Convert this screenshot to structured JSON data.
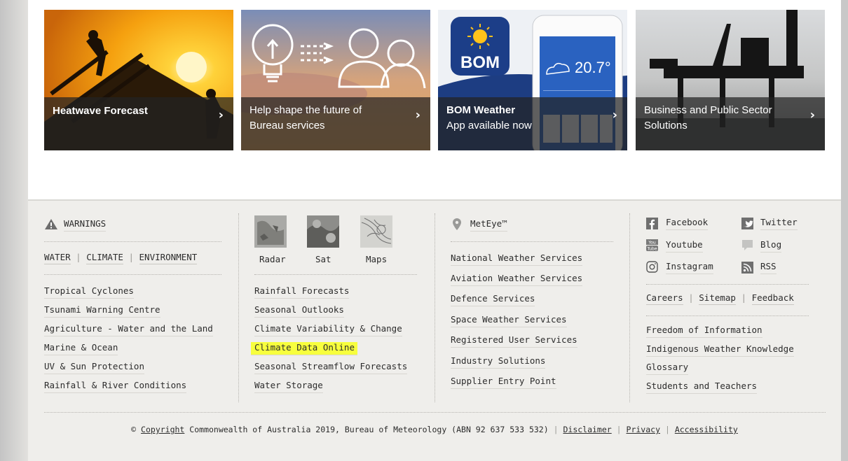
{
  "tiles": [
    {
      "title": "Heatwave Forecast",
      "subtitle": ""
    },
    {
      "title": "Help shape the future of",
      "subtitle": "Bureau services"
    },
    {
      "title": "BOM Weather",
      "subtitle": "App available now",
      "app": {
        "logo": "BOM",
        "temp": "20.7°"
      }
    },
    {
      "title": "Business and Public Sector",
      "subtitle": "Solutions"
    }
  ],
  "footer": {
    "warnings": "WARNINGS",
    "tabs": [
      "WATER",
      "CLIMATE",
      "ENVIRONMENT"
    ],
    "col1": [
      "Tropical Cyclones",
      "Tsunami Warning Centre",
      "Agriculture - Water and the Land",
      "Marine & Ocean",
      "UV & Sun Protection",
      "Rainfall & River Conditions"
    ],
    "thumbs": [
      "Radar",
      "Sat",
      "Maps"
    ],
    "col2": [
      "Rainfall Forecasts",
      "Seasonal Outlooks",
      "Climate Variability & Change",
      "Climate Data Online",
      "Seasonal Streamflow Forecasts",
      "Water Storage"
    ],
    "highlighted": "Climate Data Online",
    "meteye": "MetEye™",
    "col3": [
      "National Weather Services",
      "Aviation Weather Services",
      "Defence Services",
      "Space Weather Services",
      "Registered User Services",
      "Industry Solutions",
      "Supplier Entry Point"
    ],
    "social": [
      {
        "label": "Facebook",
        "icon": "facebook-icon"
      },
      {
        "label": "Twitter",
        "icon": "twitter-icon"
      },
      {
        "label": "Youtube",
        "icon": "youtube-icon"
      },
      {
        "label": "Blog",
        "icon": "blog-icon"
      },
      {
        "label": "Instagram",
        "icon": "instagram-icon"
      },
      {
        "label": "RSS",
        "icon": "rss-icon"
      }
    ],
    "site_links": [
      "Careers",
      "Sitemap",
      "Feedback"
    ],
    "col4": [
      "Freedom of Information",
      "Indigenous Weather Knowledge",
      "Glossary",
      "Students and Teachers"
    ],
    "copyright": {
      "symbol": "©",
      "link": "Copyright",
      "text": "Commonwealth of Australia 2019, Bureau of Meteorology (ABN 92 637 533 532)",
      "disclaimer": "Disclaimer",
      "privacy": "Privacy",
      "accessibility": "Accessibility"
    }
  },
  "colors": {
    "highlight": "#f7ff3d",
    "footer_bg": "#efeeeb",
    "text": "#2c2c2c"
  }
}
